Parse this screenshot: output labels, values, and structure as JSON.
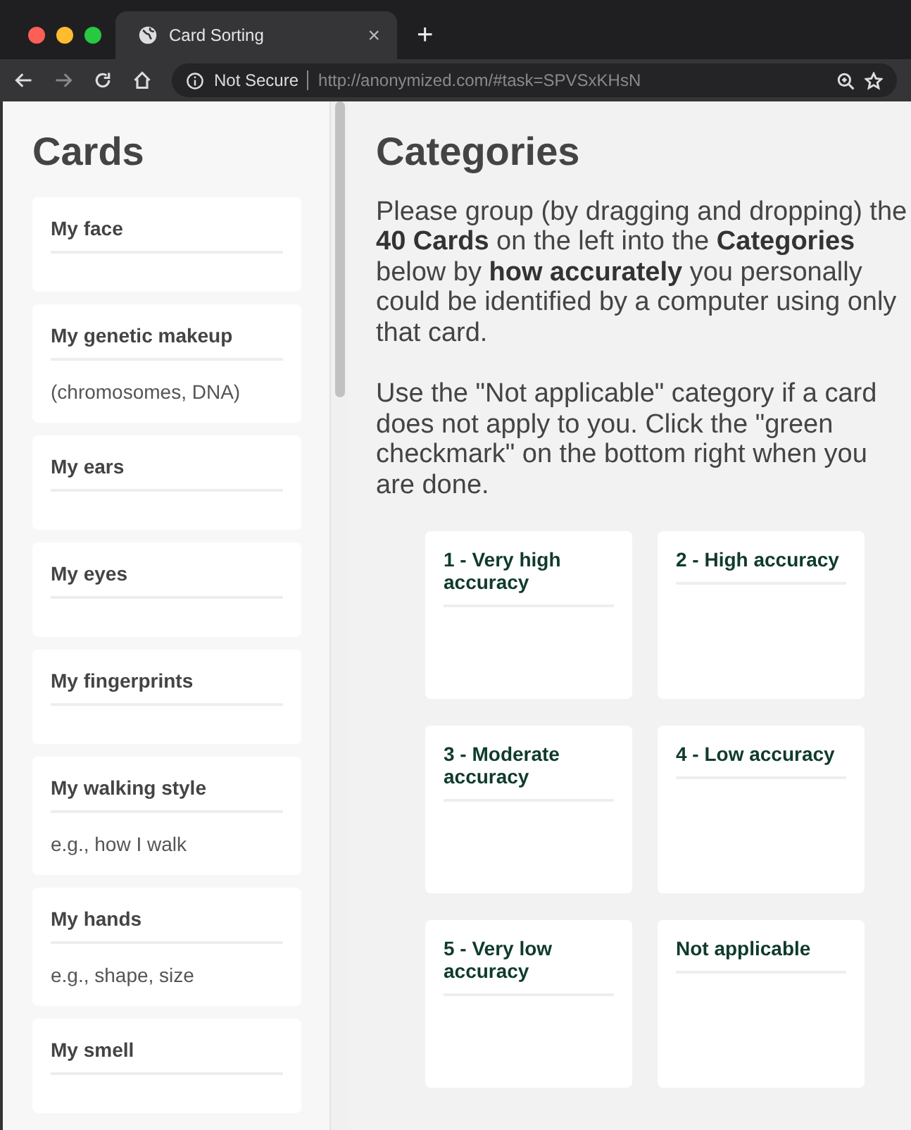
{
  "browser": {
    "tab_title": "Card Sorting",
    "new_tab": "+",
    "close": "×",
    "security": "Not Secure",
    "url": "http://anonymized.com/#task=SPVSxKHsN"
  },
  "sidebar": {
    "title": "Cards",
    "cards": [
      {
        "title": "My face"
      },
      {
        "title": "My genetic makeup",
        "description": "(chromosomes, DNA)"
      },
      {
        "title": "My ears"
      },
      {
        "title": "My eyes"
      },
      {
        "title": "My fingerprints"
      },
      {
        "title": "My walking style",
        "description": "e.g., how I walk"
      },
      {
        "title": "My hands",
        "description": "e.g., shape, size"
      },
      {
        "title": "My smell"
      }
    ]
  },
  "main": {
    "title": "Categories",
    "instructions": [
      "Please group (by dragging and dropping) the **40 Cards** on the left into the **Categories** below by **how accurately** you personally could be identified by a computer using only that card.",
      "Use the \"Not applicable\" category if a card does not apply to you. Click the \"green checkmark\" on the bottom right when you are done."
    ],
    "categories": [
      {
        "title": "1 - Very high accuracy"
      },
      {
        "title": "2 - High accuracy"
      },
      {
        "title": "3 - Moderate accuracy"
      },
      {
        "title": "4 - Low accuracy"
      },
      {
        "title": "5 - Very low accuracy"
      },
      {
        "title": "Not applicable"
      }
    ]
  }
}
